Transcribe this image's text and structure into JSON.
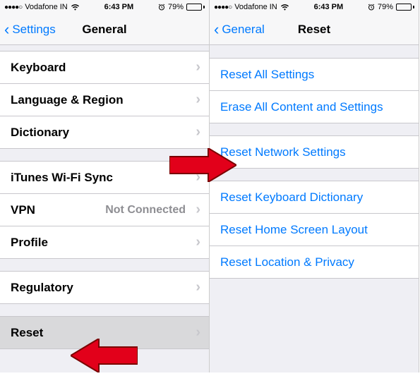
{
  "status": {
    "signal_dots": "●●●●○",
    "carrier": "Vodafone IN",
    "time": "6:43 PM",
    "battery_pct": "79%"
  },
  "left": {
    "back_label": "Settings",
    "title": "General",
    "group1": [
      {
        "label": "Keyboard"
      },
      {
        "label": "Language & Region"
      },
      {
        "label": "Dictionary"
      }
    ],
    "group2": [
      {
        "label": "iTunes Wi-Fi Sync",
        "detail": ""
      },
      {
        "label": "VPN",
        "detail": "Not Connected"
      },
      {
        "label": "Profile",
        "detail": ""
      }
    ],
    "group3": [
      {
        "label": "Regulatory"
      }
    ],
    "group4": [
      {
        "label": "Reset"
      }
    ]
  },
  "right": {
    "back_label": "General",
    "title": "Reset",
    "group1": [
      {
        "label": "Reset All Settings"
      },
      {
        "label": "Erase All Content and Settings"
      }
    ],
    "group2": [
      {
        "label": "Reset Network Settings"
      }
    ],
    "group3": [
      {
        "label": "Reset Keyboard Dictionary"
      },
      {
        "label": "Reset Home Screen Layout"
      },
      {
        "label": "Reset Location & Privacy"
      }
    ]
  }
}
